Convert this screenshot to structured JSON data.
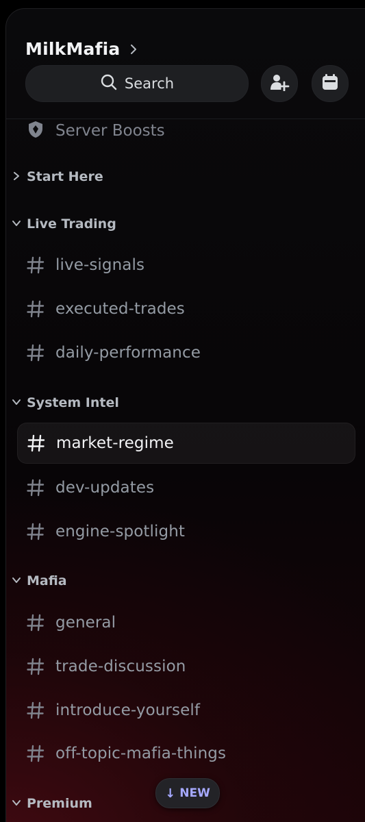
{
  "server": {
    "name": "MilkMafia"
  },
  "search": {
    "label": "Search"
  },
  "header_icons": [
    "add-member-icon",
    "calendar-events-icon"
  ],
  "boosts": {
    "label": "Server Boosts"
  },
  "categories": [
    {
      "name": "Start Here",
      "collapsed": true,
      "channels": []
    },
    {
      "name": "Live Trading",
      "collapsed": false,
      "channels": [
        "live-signals",
        "executed-trades",
        "daily-performance"
      ]
    },
    {
      "name": "System Intel",
      "collapsed": false,
      "channels": [
        "market-regime",
        "dev-updates",
        "engine-spotlight"
      ]
    },
    {
      "name": "Mafia",
      "collapsed": false,
      "channels": [
        "general",
        "trade-discussion",
        "introduce-yourself",
        "off-topic-mafia-things"
      ]
    },
    {
      "name": "Premium",
      "collapsed": false,
      "channels": []
    }
  ],
  "active_channel": "market-regime",
  "new_pill": {
    "label": "NEW"
  },
  "colors": {
    "accent": "#a6a9ff",
    "text_primary": "#f2f3f5",
    "text_muted": "#949ba4",
    "category": "#b5bac1"
  }
}
